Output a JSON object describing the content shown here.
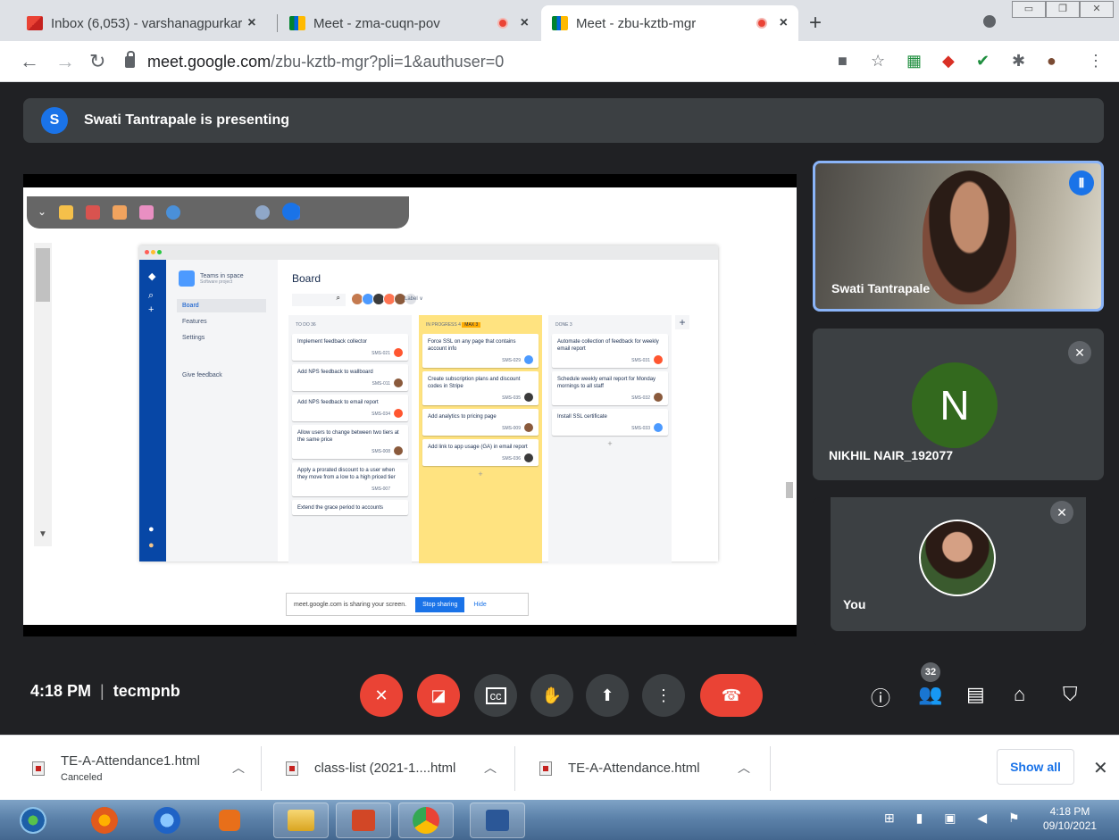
{
  "tabs": [
    {
      "label": "Inbox (6,053) - varshanagpurkar",
      "close": "×",
      "icon": "gmail-icon"
    },
    {
      "label": "Meet - zma-cuqn-pov",
      "close": "×",
      "icon": "meet-icon"
    },
    {
      "label": "Meet - zbu-kztb-mgr",
      "close": "×",
      "icon": "meet-icon"
    }
  ],
  "new_tab": "+",
  "address": {
    "host": "meet.google.com",
    "path": "/zbu-kztb-mgr?pli=1&authuser=0"
  },
  "presenting_banner": {
    "avatar_letter": "S",
    "text": "Swati Tantrapale is presenting"
  },
  "shared_screen": {
    "board_title": "Board",
    "project_name": "Teams in space",
    "project_sub": "Software project",
    "nav_items": [
      "Board",
      "Features",
      "Settings",
      "Give feedback"
    ],
    "label_filter": "Label ∨",
    "columns": [
      {
        "header": "TO DO  36",
        "badge": "",
        "cards": [
          {
            "text": "Implement feedback collector",
            "key": "SMS-021"
          },
          {
            "text": "Add NPS feedback to wallboard",
            "key": "SMS-011"
          },
          {
            "text": "Add NPS feedback to email report",
            "key": "SMS-034"
          },
          {
            "text": "Allow users to change between two tiers at the same price",
            "key": "SMS-008"
          },
          {
            "text": "Apply a prorated discount to a user when they move from a low to a high priced tier",
            "key": "SMS-007"
          },
          {
            "text": "Extend the grace period to accounts",
            "key": ""
          }
        ]
      },
      {
        "header": "IN PROGRESS  4",
        "badge": "MAX 3",
        "cards": [
          {
            "text": "Force SSL on any page that contains account info",
            "key": "SMS-029"
          },
          {
            "text": "Create subscription plans and discount codes in Stripe",
            "key": "SMS-035"
          },
          {
            "text": "Add analytics to pricing page",
            "key": "SMS-009"
          },
          {
            "text": "Add link to app usage (GA) in email report",
            "key": "SMS-036"
          }
        ]
      },
      {
        "header": "DONE  3",
        "badge": "",
        "cards": [
          {
            "text": "Automate collection of feedback for weekly email report",
            "key": "SMS-031"
          },
          {
            "text": "Schedule weekly email report for Monday mornings to all staff",
            "key": "SMS-032"
          },
          {
            "text": "Install SSL certificate",
            "key": "SMS-033"
          }
        ]
      }
    ],
    "share_notice": "meet.google.com is sharing your screen.",
    "stop_sharing": "Stop sharing",
    "hide": "Hide"
  },
  "participants": [
    {
      "name": "Swati Tantrapale",
      "speaking": true
    },
    {
      "name": "NIKHIL NAIR_192077",
      "avatar_letter": "N",
      "muted": true
    },
    {
      "name": "You",
      "muted": true
    }
  ],
  "meeting_info": {
    "time": "4:18 PM",
    "separator": "|",
    "code": "tecmpnb"
  },
  "people_count": "32",
  "downloads": [
    {
      "name": "TE-A-Attendance1.html",
      "status": "Canceled"
    },
    {
      "name": "class-list (2021-1....html",
      "status": ""
    },
    {
      "name": "TE-A-Attendance.html",
      "status": ""
    }
  ],
  "show_all": "Show all",
  "clock": {
    "time": "4:18 PM",
    "date": "09/10/2021"
  },
  "colors": {
    "meet_bg": "#202124",
    "tile_bg": "#3c4043",
    "danger": "#ea4335",
    "accent": "#1a73e8"
  }
}
